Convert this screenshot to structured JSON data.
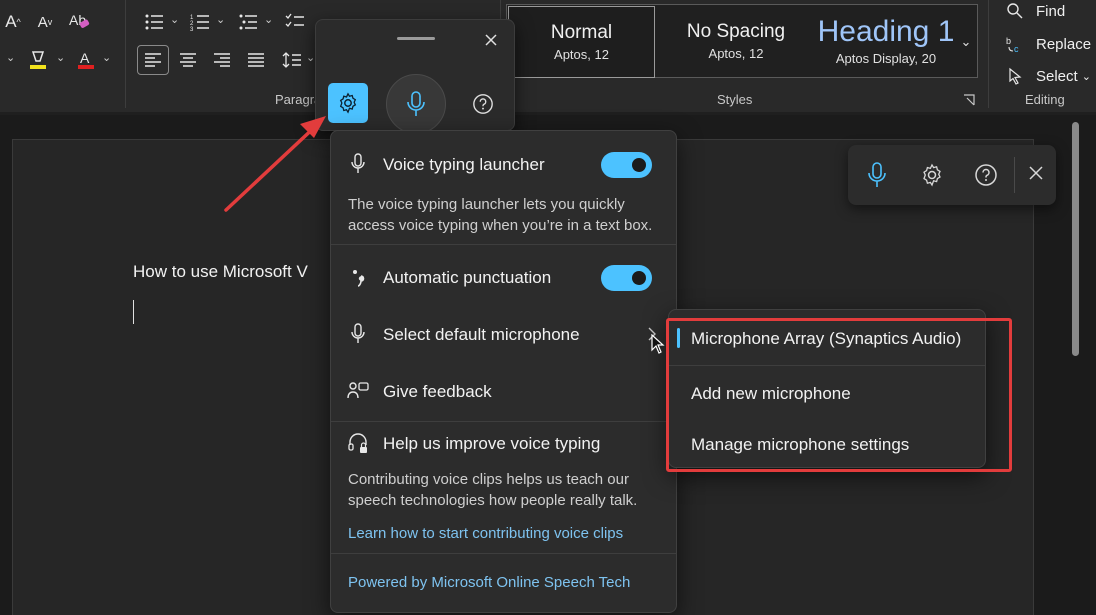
{
  "ribbon": {
    "paragraph_label": "Paragra",
    "styles_label": "Styles",
    "editing_label": "Editing",
    "styles": [
      {
        "name": "Normal",
        "font": "Aptos, 12"
      },
      {
        "name": "No Spacing",
        "font": "Aptos, 12"
      },
      {
        "name": "Heading 1",
        "font": "Aptos Display, 20"
      }
    ],
    "find_label": "Find",
    "replace_label": "Replace",
    "select_label": "Select"
  },
  "document": {
    "text": "How to use Microsoft V"
  },
  "settings_menu": {
    "launcher_label": "Voice typing launcher",
    "launcher_desc": "The voice typing launcher lets you quickly access voice typing when you’re in a text box.",
    "launcher_on": true,
    "punctuation_label": "Automatic punctuation",
    "punctuation_on": true,
    "microphone_label": "Select default microphone",
    "feedback_label": "Give feedback",
    "improve_label": "Help us improve voice typing",
    "improve_desc": "Contributing voice clips helps us teach our speech technologies how people really talk.",
    "learn_link": "Learn how to start contributing voice clips",
    "powered_by": "Powered by Microsoft Online Speech Tech"
  },
  "microphone_submenu": {
    "items": [
      {
        "label": "Microphone Array (Synaptics Audio)",
        "selected": true
      },
      {
        "label": "Add new microphone",
        "selected": false
      },
      {
        "label": "Manage microphone settings",
        "selected": false
      }
    ]
  },
  "colors": {
    "accent": "#4cc2ff",
    "annotation": "#e23c3c",
    "heading_style": "#9fc5f8"
  }
}
